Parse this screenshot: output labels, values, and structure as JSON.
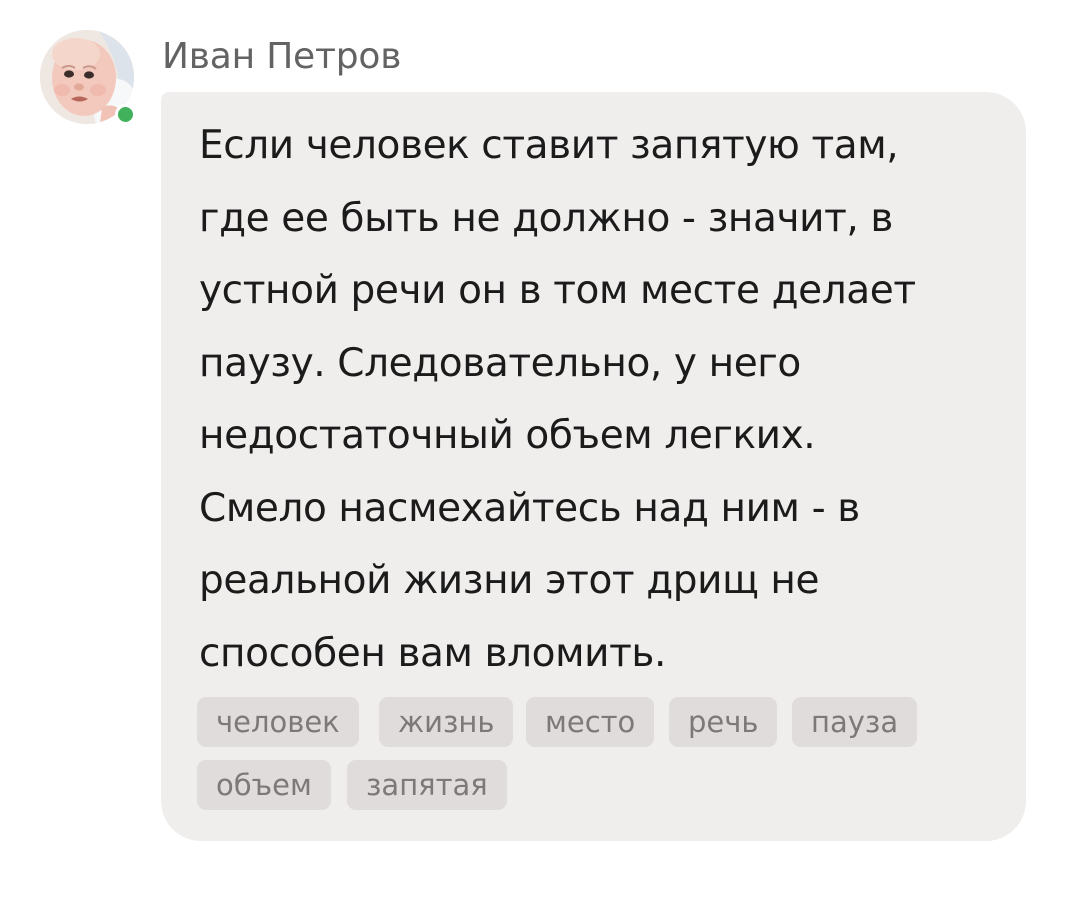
{
  "post": {
    "author": {
      "name": "Иван Петров",
      "online": true
    },
    "message_lines": [
      "Если человек ставит запятую там,",
      "где ее быть не должно - значит, в",
      "устной речи он в том месте делает",
      "паузу. Следовательно, у него",
      "недостаточный объем легких.",
      "Смело насмехайтесь над ним - в",
      "реальной жизни этот дрищ не",
      "способен вам вломить."
    ],
    "tags": [
      "человек",
      "жизнь",
      "место",
      "речь",
      "пауза",
      "объем",
      "запятая"
    ]
  },
  "colors": {
    "bubble_background": "#f0eeed",
    "tag_background": "#dfdcdb",
    "tag_text": "#7d7978",
    "author_text": "#636363",
    "message_text": "#1b1b1b",
    "online_indicator": "#41b25b"
  },
  "icons": {
    "avatar": "user-avatar-photo",
    "status": "online-status-dot"
  }
}
